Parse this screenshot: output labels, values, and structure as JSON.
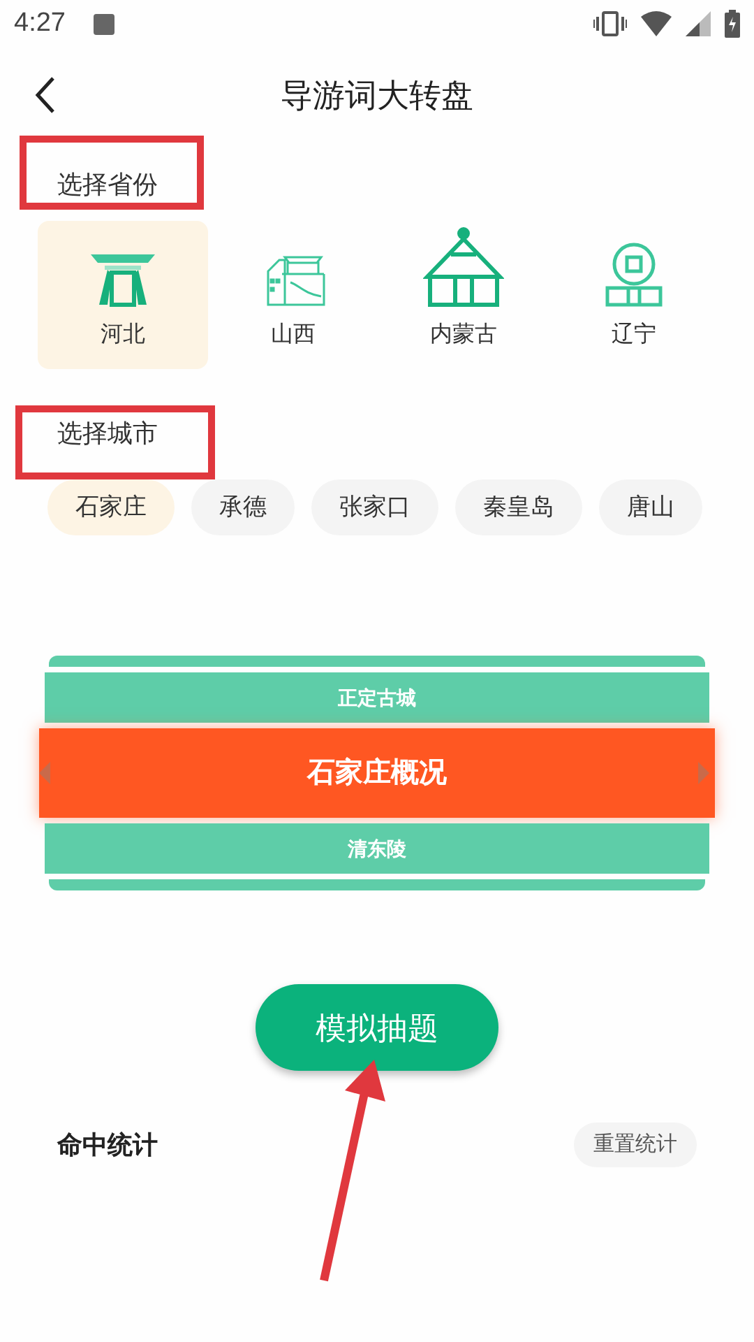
{
  "status_bar": {
    "time": "4:27"
  },
  "header": {
    "title": "导游词大转盘"
  },
  "province_section": {
    "label": "选择省份"
  },
  "provinces": [
    {
      "name": "河北",
      "selected": true,
      "kind": "pavilion"
    },
    {
      "name": "山西",
      "selected": false,
      "kind": "palace"
    },
    {
      "name": "内蒙古",
      "selected": false,
      "kind": "yurt"
    },
    {
      "name": "辽宁",
      "selected": false,
      "kind": "coin"
    }
  ],
  "city_section": {
    "label": "选择城市"
  },
  "cities": [
    {
      "name": "石家庄",
      "selected": true
    },
    {
      "name": "承德",
      "selected": false
    },
    {
      "name": "张家口",
      "selected": false
    },
    {
      "name": "秦皇岛",
      "selected": false
    },
    {
      "name": "唐山",
      "selected": false
    }
  ],
  "wheel": {
    "items": [
      {
        "label": "正定古城",
        "selected": false
      },
      {
        "label": "石家庄概况",
        "selected": true
      },
      {
        "label": "清东陵",
        "selected": false
      }
    ]
  },
  "draw_button": {
    "label": "模拟抽题"
  },
  "stats": {
    "title": "命中统计",
    "reset_button": "重置统计"
  }
}
